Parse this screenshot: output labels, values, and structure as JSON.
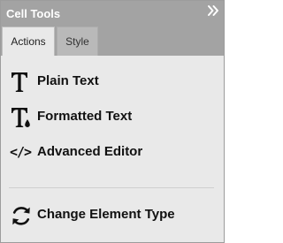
{
  "panel": {
    "title": "Cell Tools",
    "collapse_icon": "double-chevron-right-icon"
  },
  "tabs": [
    {
      "label": "Actions",
      "active": true
    },
    {
      "label": "Style",
      "active": false
    }
  ],
  "actions": [
    {
      "label": "Plain Text",
      "icon": "text-t-icon"
    },
    {
      "label": "Formatted Text",
      "icon": "formatted-text-t-icon"
    },
    {
      "label": "Advanced Editor",
      "icon": "code-icon",
      "glyph": "</>"
    }
  ],
  "secondary_actions": [
    {
      "label": "Change Element Type",
      "icon": "refresh-cycle-icon"
    }
  ],
  "colors": {
    "header_bg": "#a3a3a3",
    "body_bg": "#e9e9e9",
    "inactive_tab_bg": "#b9b9b9",
    "text": "#111111"
  }
}
